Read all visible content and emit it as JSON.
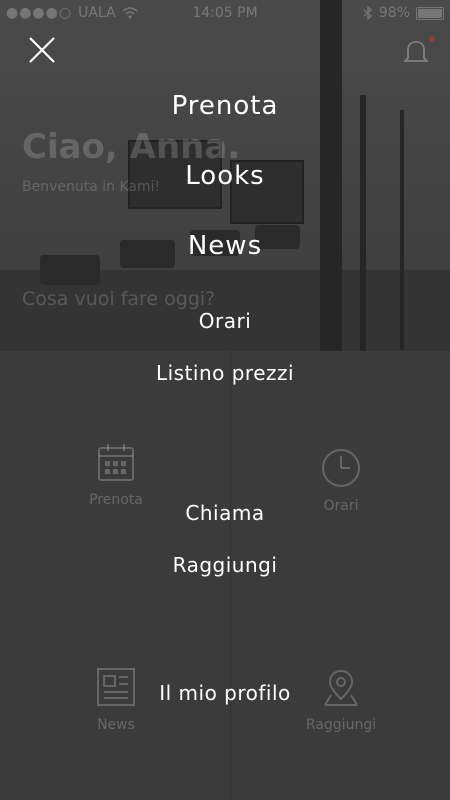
{
  "status_bar": {
    "carrier": "UALA",
    "time": "14:05 PM",
    "battery": "98%",
    "battery_level": 0.98
  },
  "background": {
    "greeting": "Ciao, Anna.",
    "welcome": "Benvenuta in Kami!",
    "question": "Cosa vuoi fare oggi?",
    "grid": [
      {
        "label": "Prenota",
        "icon": "calendar-icon"
      },
      {
        "label": "Orari",
        "icon": "clock-icon"
      },
      {
        "label": "News",
        "icon": "newspaper-icon"
      },
      {
        "label": "Raggiungi",
        "icon": "map-pin-icon"
      }
    ]
  },
  "menu": {
    "close_icon": "close-icon",
    "items": [
      {
        "label": "Prenota"
      },
      {
        "label": "Looks"
      },
      {
        "label": "News"
      },
      {
        "label": "Orari"
      },
      {
        "label": "Listino prezzi"
      },
      {
        "label": "Chiama"
      },
      {
        "label": "Raggiungi"
      },
      {
        "label": "Il mio profilo"
      }
    ]
  },
  "colors": {
    "overlay_bg": "#3b3b3b",
    "menu_text": "#ffffff",
    "notification_dot": "#c0392b"
  }
}
